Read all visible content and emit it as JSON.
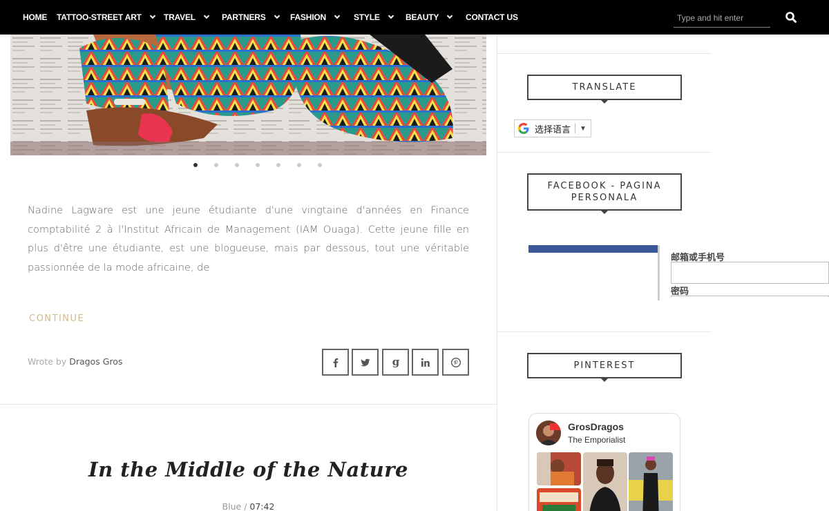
{
  "nav": {
    "items": [
      {
        "label": "HOME"
      },
      {
        "label": "TATTOO-STREET ART"
      },
      {
        "label": "TRAVEL"
      },
      {
        "label": "PARTNERS"
      },
      {
        "label": "FASHION"
      },
      {
        "label": "STYLE"
      },
      {
        "label": "BEAUTY"
      },
      {
        "label": "CONTACT US"
      }
    ],
    "search_placeholder": "Type and hit enter"
  },
  "slider": {
    "dot_count": 7,
    "active_index": 0
  },
  "post": {
    "excerpt": "Nadine Lagware est une jeune étudiante d'une vingtaine d'années en Finance comptabilité 2 à l'Institut Africain de Management (IAM Ouaga). Cette jeune fille en plus d'être une étudiante, est une blogueuse, mais par dessous, tout une véritable passionnée de la mode africaine, de",
    "continue_label": "CONTINUE",
    "wrote_by": "Wrote by",
    "author": "Dragos Gros",
    "share_icons": [
      "facebook-icon",
      "twitter-icon",
      "google-plus-icon",
      "linkedin-icon",
      "pinterest-icon"
    ]
  },
  "next_post": {
    "title": "In the Middle of the Nature",
    "category": "Blue",
    "separator": "/",
    "time": "07:42"
  },
  "sidebar": {
    "translate": {
      "title": "TRANSLATE",
      "select_label": "选择语言",
      "arrow": "▼"
    },
    "facebook": {
      "title": "FACEBOOK - PAGINA PERSONALA",
      "email_label": "邮箱或手机号",
      "password_label": "密码"
    },
    "pinterest": {
      "title": "PINTEREST",
      "profile_name": "GrosDragos",
      "board_name": "The Emporialist"
    }
  },
  "colors": {
    "nav_bg": "#000000",
    "accent": "#d2b98a",
    "facebook_blue": "#3b5998"
  }
}
